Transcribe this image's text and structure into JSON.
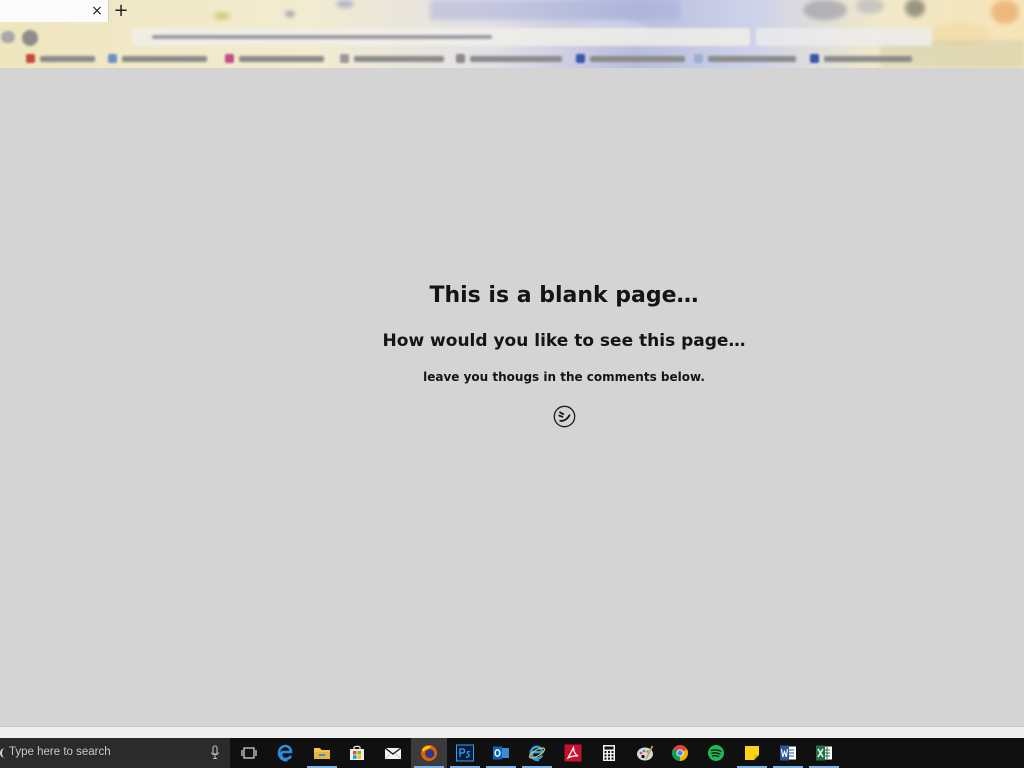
{
  "browser": {
    "tab_close_glyph": "×",
    "new_tab_glyph": "+"
  },
  "page": {
    "heading": "This is a blank page…",
    "subheading": "How would you like to see this page…",
    "note": "leave you thougs in the comments below.",
    "emoji_icon": "smile-icon"
  },
  "taskbar": {
    "search_placeholder": "Type here to search",
    "apps": [
      {
        "name": "task-view",
        "running": false
      },
      {
        "name": "edge",
        "running": false
      },
      {
        "name": "file-explorer",
        "running": true
      },
      {
        "name": "store",
        "running": false
      },
      {
        "name": "mail",
        "running": false
      },
      {
        "name": "firefox",
        "running": true,
        "active": true
      },
      {
        "name": "photoshop",
        "running": true
      },
      {
        "name": "outlook",
        "running": true
      },
      {
        "name": "internet-explorer",
        "running": true
      },
      {
        "name": "acrobat",
        "running": false
      },
      {
        "name": "calculator",
        "running": false
      },
      {
        "name": "paint",
        "running": false
      },
      {
        "name": "chrome",
        "running": false
      },
      {
        "name": "spotify",
        "running": false
      },
      {
        "name": "sticky-notes",
        "running": true
      },
      {
        "name": "word",
        "running": true
      },
      {
        "name": "excel",
        "running": true
      }
    ]
  },
  "colors": {
    "page_bg": "#d4d4d4",
    "taskbar_bg": "#101010",
    "text": "#141414",
    "running_indicator": "#7fb2e6"
  }
}
